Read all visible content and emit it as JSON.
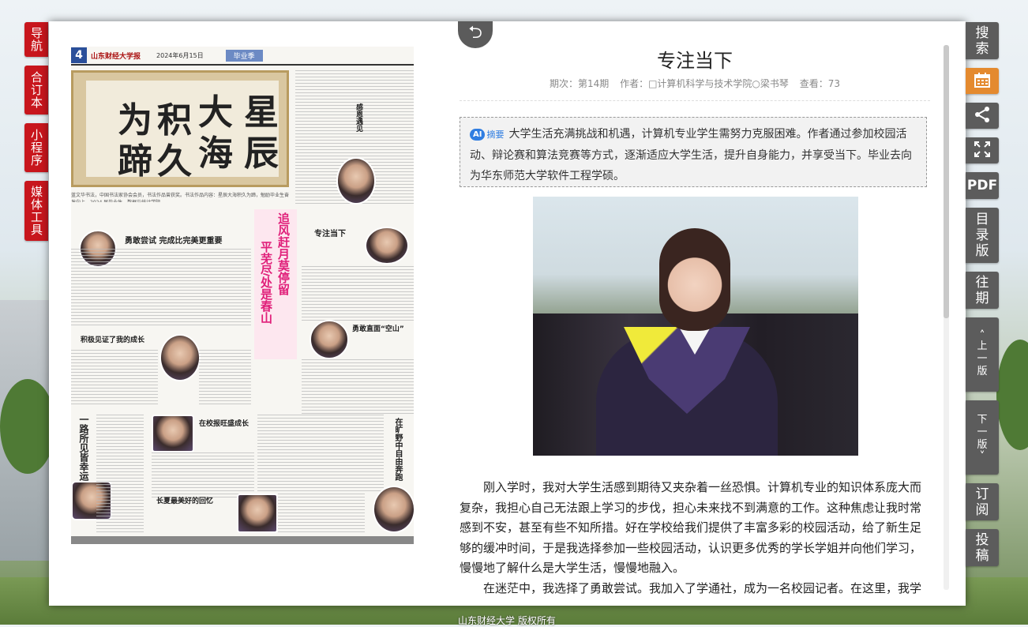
{
  "left_tabs": [
    "导航",
    "合订本",
    "小程序",
    "媒体工具"
  ],
  "back_button": {
    "icon": "back-arrow-icon"
  },
  "newspaper": {
    "page_number": "4",
    "name": "山东财经大学报",
    "date": "2024年6月15日",
    "section": "毕业季",
    "caption": "蓝文华书法，中国书法家协会会员，书法作品曾获奖。书法作品内容：星辰大海积久为蹄，勉励毕业生奋发向上。2024 届毕业生，数据与统计学院",
    "calligraphy_chars": [
      "星",
      "辰",
      "大",
      "海",
      "积",
      "久",
      "为",
      "蹄"
    ],
    "headlines": [
      "勇敢尝试  完成比完美更重要",
      "专注当下",
      "积极见证了我的成长",
      "勇敢直面“空山”",
      "在校报旺盛成长",
      "一路所见皆幸运",
      "在旷野中自由奔跑",
      "长夏最美好的回忆",
      "感恩遇见"
    ],
    "poem_lines": [
      "追风赶月莫停留",
      "平芜尽处是春山"
    ]
  },
  "article": {
    "title": "专注当下",
    "issue": "期次：第14期",
    "author": "作者：□计算机科学与技术学院○梁书琴",
    "views": "查看：73",
    "abstract_badge": "AI",
    "abstract_label": "摘要",
    "abstract": "大学生活充满挑战和机遇，计算机专业学生需努力克服困难。作者通过参加校园活动、辩论赛和算法竞赛等方式，逐渐适应大学生活，提升自身能力，并享受当下。毕业去向为华东师范大学软件工程学硕。",
    "paragraphs": [
      "刚入学时，我对大学生活感到期待又夹杂着一丝恐惧。计算机专业的知识体系庞大而复杂，我担心自己无法跟上学习的步伐，担心未来找不到满意的工作。这种焦虑让我时常感到不安，甚至有些不知所措。好在学校给我们提供了丰富多彩的校园活动，给了新生足够的缓冲时间，于是我选择参加一些校园活动，认识更多优秀的学长学姐并向他们学习，慢慢地了解什么是大学生活，慢慢地融入。",
      "在迷茫中，我选择了勇敢尝试。我加入了学通社，成为一名校园记者。在这里，我学会了用"
    ]
  },
  "right_toolbar": {
    "search": "搜索",
    "calendar_icon": "calendar-icon",
    "share_icon": "share-icon",
    "fullscreen_icon": "fullscreen-icon",
    "pdf": "PDF",
    "toc": "目录版",
    "past": "往期",
    "prev": "上一版",
    "next": "下一版",
    "subscribe": "订阅",
    "submit": "投稿"
  },
  "footer": {
    "copyright": "山东财经大学 版权所有"
  }
}
